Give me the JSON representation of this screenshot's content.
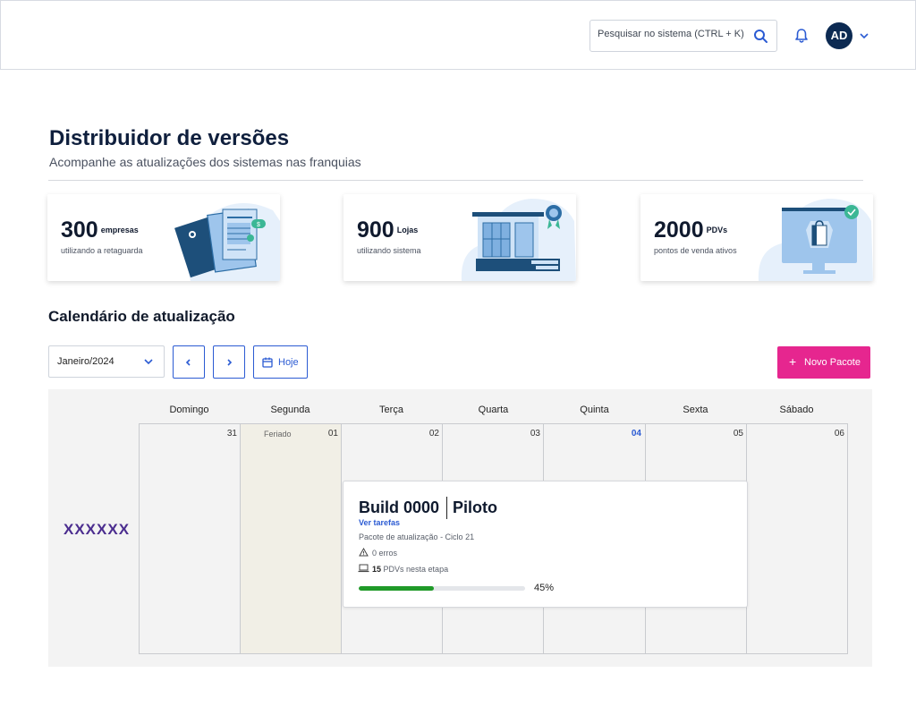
{
  "topbar": {
    "search_placeholder": "Pesquisar no sistema (CTRL + K)",
    "avatar_initials": "AD"
  },
  "header": {
    "title": "Distribuidor de versões",
    "subtitle": "Acompanhe as atualizações dos sistemas nas franquias"
  },
  "stats": [
    {
      "value": "300",
      "unit": "empresas",
      "desc": "utilizando a retaguarda",
      "icon": "documents-illustration"
    },
    {
      "value": "900",
      "unit": "Lojas",
      "desc": "utilizando sistema",
      "icon": "store-illustration"
    },
    {
      "value": "2000",
      "unit": "PDVs",
      "desc": "pontos de venda ativos",
      "icon": "monitor-illustration"
    }
  ],
  "calendar": {
    "title": "Calendário de atualização",
    "month": "Janeiro/2024",
    "today_label": "Hoje",
    "new_label": "Novo Pacote",
    "weekdays": [
      "Domingo",
      "Segunda",
      "Terça",
      "Quarta",
      "Quinta",
      "Sexta",
      "Sábado"
    ],
    "days": [
      "31",
      "01",
      "02",
      "03",
      "04",
      "05",
      "06"
    ],
    "holiday_label": "Feriado",
    "row_label": "XXXXXX"
  },
  "event": {
    "build": "Build 0000",
    "phase": "Piloto",
    "link": "Ver tarefas",
    "package": "Pacote de atualização - Ciclo 21",
    "errors": "0 erros",
    "pdv_count": "15",
    "pdv_text": "PDVs nesta etapa",
    "progress_label": "45%",
    "progress": 0.45
  },
  "colors": {
    "accent_blue": "#2b5bd3",
    "primary_pink": "#e6268f",
    "progress_green": "#1f9a28",
    "row_label_purple": "#4b2d8f"
  }
}
